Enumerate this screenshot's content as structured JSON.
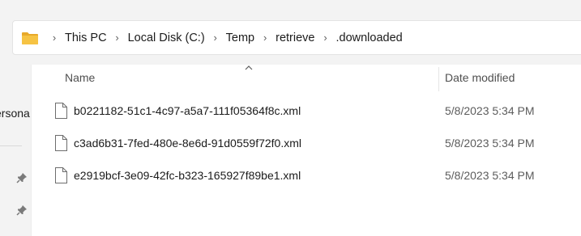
{
  "address_bar": {
    "icon": "folder-icon",
    "breadcrumbs": [
      "This PC",
      "Local Disk (C:)",
      "Temp",
      "retrieve",
      ".downloaded"
    ]
  },
  "nav_pane": {
    "partial_label": "ersona",
    "pins": [
      "pin-icon",
      "pin-icon"
    ]
  },
  "columns": {
    "name": "Name",
    "date_modified": "Date modified"
  },
  "files": [
    {
      "name": "b0221182-51c1-4c97-a5a7-111f05364f8c.xml",
      "date": "5/8/2023 5:34 PM"
    },
    {
      "name": "c3ad6b31-7fed-480e-8e6d-91d0559f72f0.xml",
      "date": "5/8/2023 5:34 PM"
    },
    {
      "name": "e2919bcf-3e09-42fc-b323-165927f89be1.xml",
      "date": "5/8/2023 5:34 PM"
    }
  ],
  "colors": {
    "folder": "#f6c343",
    "window_bg": "#f3f3f3",
    "content_bg": "#ffffff"
  }
}
